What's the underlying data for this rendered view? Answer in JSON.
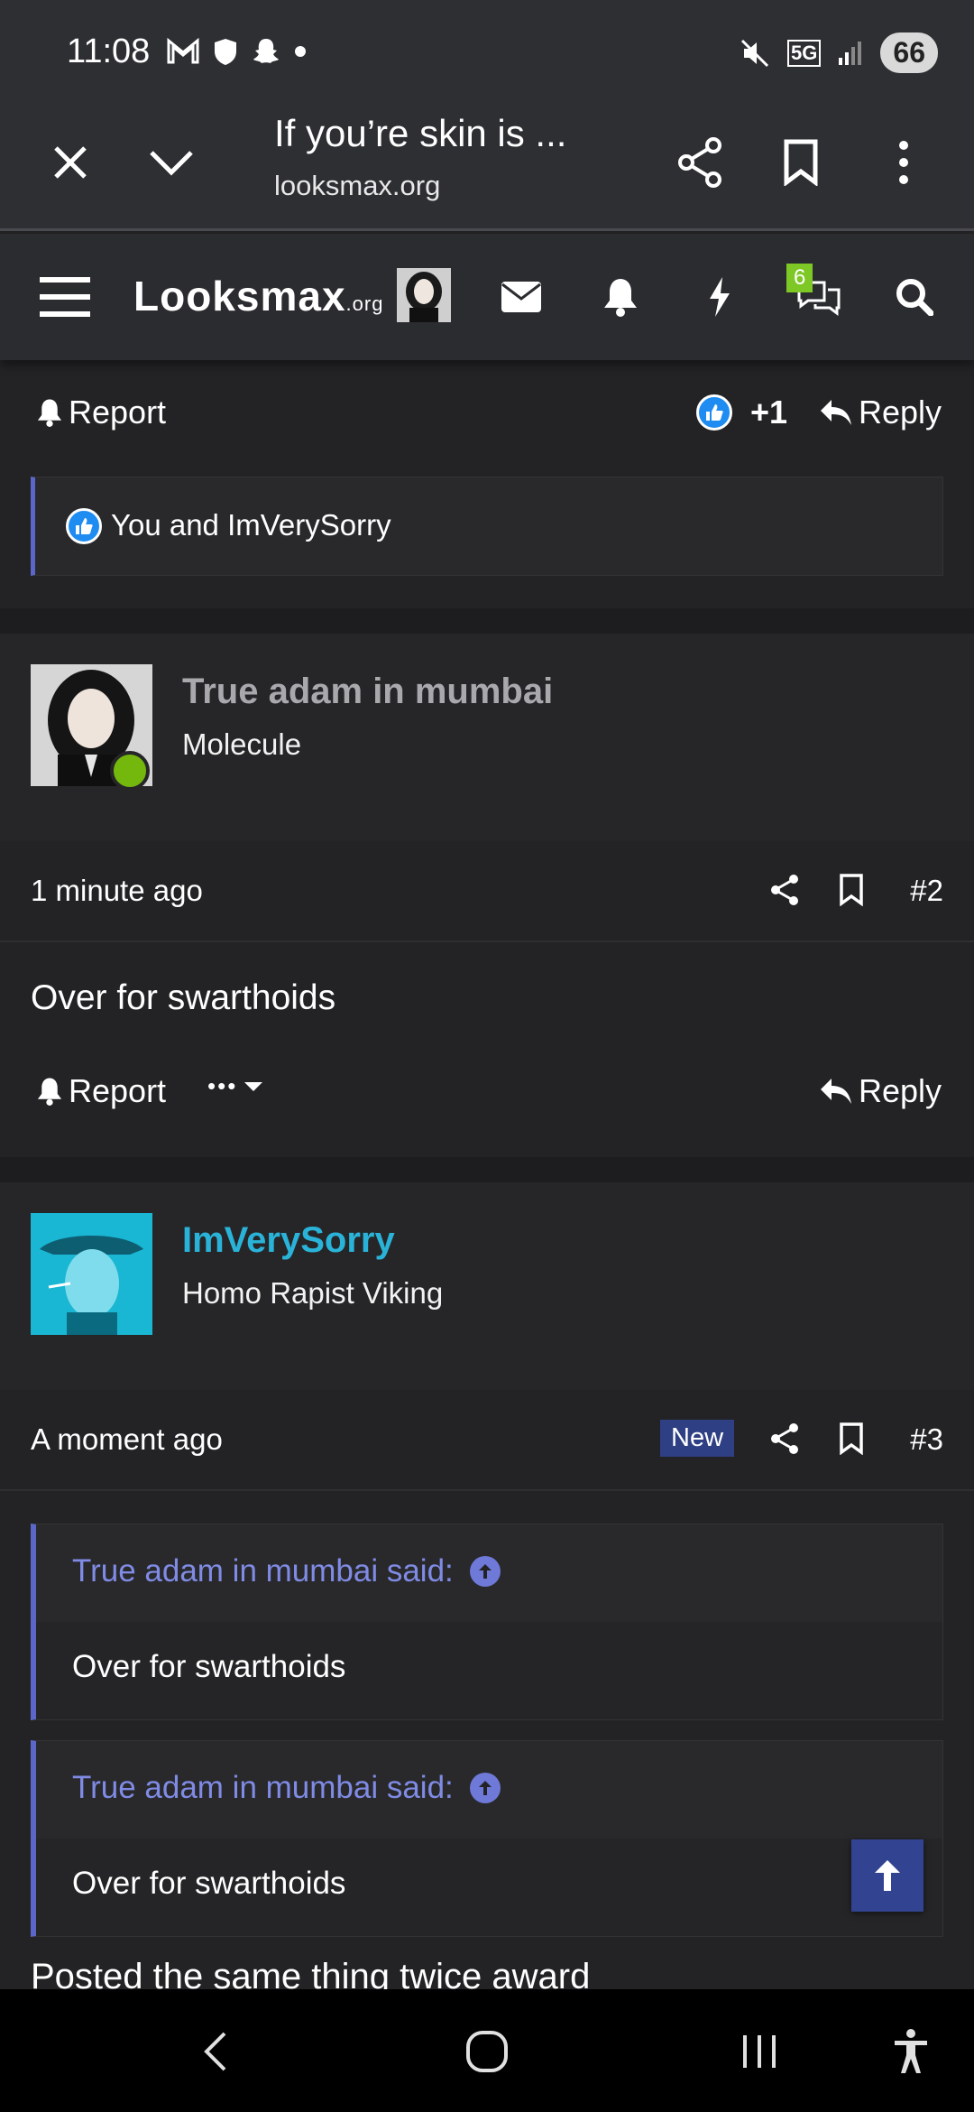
{
  "status_bar": {
    "time": "11:08",
    "network": "5G",
    "battery": "66"
  },
  "browser": {
    "page_title": "If you’re skin is ...",
    "url": "looksmax.org"
  },
  "site_nav": {
    "logo_main": "Looksmax",
    "logo_suffix": ".org",
    "conversations_badge": "6"
  },
  "post1_actions": {
    "report": "Report",
    "reaction_count": "+1",
    "reply": "Reply",
    "reactions_summary": "You and ImVerySorry"
  },
  "post2": {
    "username": "True adam in mumbai",
    "user_title": "Molecule",
    "time": "1 minute ago",
    "number": "#2",
    "body": "Over for swarthoids",
    "report": "Report",
    "more": "•••",
    "reply": "Reply"
  },
  "post3": {
    "username": "ImVerySorry",
    "user_title": "Homo Rapist Viking",
    "time": "A moment ago",
    "new_label": "New",
    "number": "#3",
    "quotes": [
      {
        "author": "True adam in mumbai said:",
        "text": "Over for swarthoids"
      },
      {
        "author": "True adam in mumbai said:",
        "text": "Over for swarthoids"
      }
    ],
    "body_partial": "Posted the same thing twice award"
  },
  "colors": {
    "accent_blue": "#5b67c8",
    "username_cyan": "#2ab3d9",
    "username_gray": "#a9a9ad",
    "online_green": "#75b80d"
  }
}
